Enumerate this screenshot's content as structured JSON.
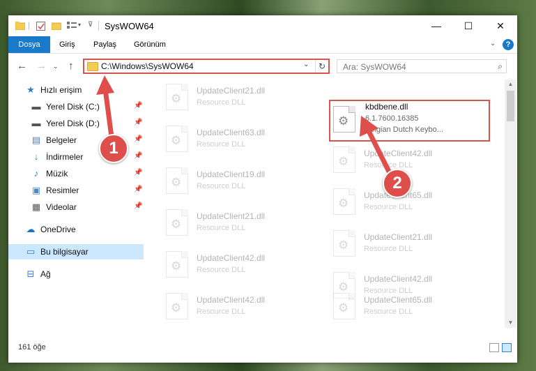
{
  "window": {
    "title": "SysWOW64"
  },
  "ribbon": {
    "tabs": [
      "Dosya",
      "Giriş",
      "Paylaş",
      "Görünüm"
    ]
  },
  "address": {
    "path": "C:\\Windows\\SysWOW64",
    "search_placeholder": "Ara: SysWOW64"
  },
  "sidebar": {
    "items": [
      {
        "label": "Hızlı erişim",
        "icon": "star-icon"
      },
      {
        "label": "Yerel Disk (C:)",
        "icon": "drive-icon",
        "pinned": true
      },
      {
        "label": "Yerel Disk (D:)",
        "icon": "drive-icon",
        "pinned": true
      },
      {
        "label": "Belgeler",
        "icon": "document-icon",
        "pinned": true
      },
      {
        "label": "İndirmeler",
        "icon": "download-icon",
        "pinned": true
      },
      {
        "label": "Müzik",
        "icon": "music-icon",
        "pinned": true
      },
      {
        "label": "Resimler",
        "icon": "pictures-icon",
        "pinned": true
      },
      {
        "label": "Videolar",
        "icon": "video-icon",
        "pinned": true
      },
      {
        "label": "OneDrive",
        "icon": "cloud-icon"
      },
      {
        "label": "Bu bilgisayar",
        "icon": "computer-icon",
        "selected": true
      },
      {
        "label": "Ağ",
        "icon": "network-icon"
      }
    ]
  },
  "files": {
    "featured": {
      "name": "kbdbene.dll",
      "version": "6.1.7600.16385",
      "description": "Belgian Dutch Keybo..."
    },
    "left_column": [
      {
        "name": "UpdateClient21.dll",
        "desc": "Resource DLL"
      },
      {
        "name": "UpdateClient63.dll",
        "desc": "Resource DLL"
      },
      {
        "name": "UpdateClient19.dll",
        "desc": "Resource DLL"
      },
      {
        "name": "UpdateClient21.dll",
        "desc": "Resource DLL"
      },
      {
        "name": "UpdateClient42.dll",
        "desc": "Resource DLL"
      },
      {
        "name": "UpdateClient42.dll",
        "desc": "Resource DLL"
      }
    ],
    "right_column": [
      {
        "name": "UpdateClient42.dll",
        "desc": "Resource DLL"
      },
      {
        "name": "UpdateClient65.dll",
        "desc": "Resource DLL"
      },
      {
        "name": "UpdateClient21.dll",
        "desc": "Resource DLL"
      },
      {
        "name": "UpdateClient42.dll",
        "desc": "Resource DLL"
      },
      {
        "name": "UpdateClient65.dll",
        "desc": "Resource DLL"
      }
    ]
  },
  "status": {
    "count": "161 öğe"
  },
  "annotations": {
    "badge1": "1",
    "badge2": "2",
    "color": "#de4f4c"
  }
}
